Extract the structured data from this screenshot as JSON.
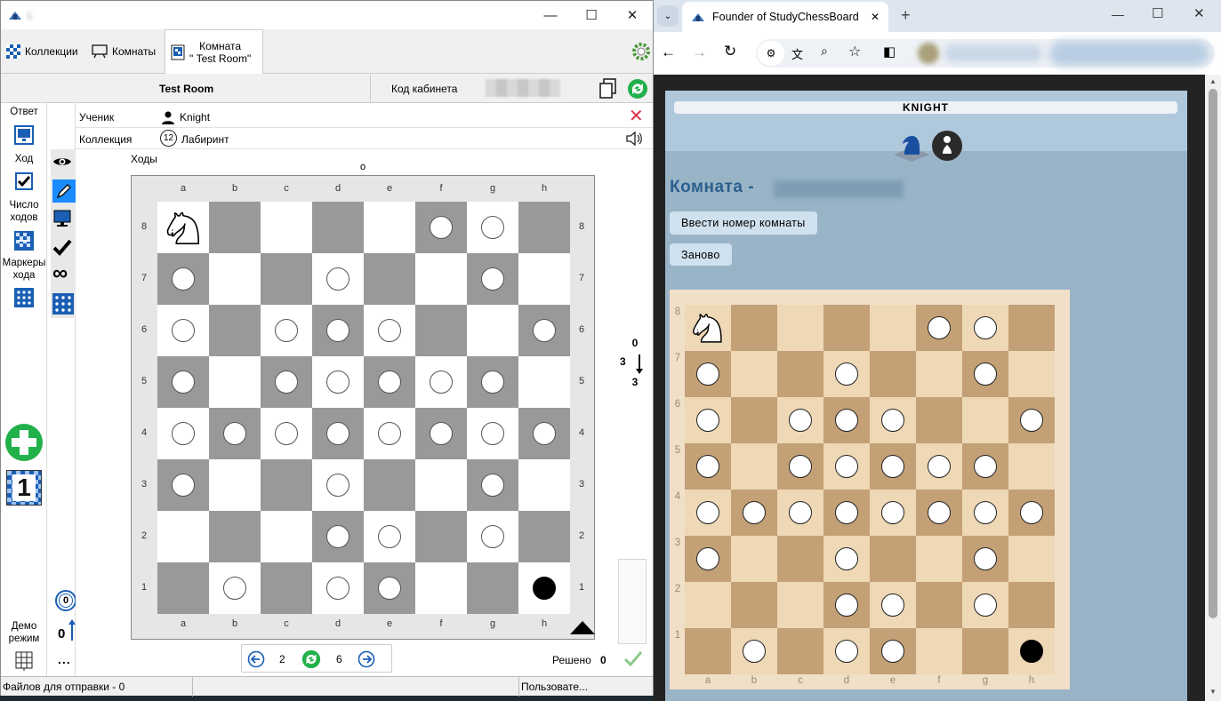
{
  "app": {
    "window_title": "L",
    "tabs": [
      {
        "label": "Коллекции"
      },
      {
        "label": "Комнаты"
      },
      {
        "label": "Комната\n\" Test Room\""
      }
    ],
    "header": {
      "room_name": "Test Room",
      "cabinet_code_label": "Код кабинета"
    },
    "left_panel": {
      "answer": "Ответ",
      "move": "Ход",
      "move_count": "Число ходов",
      "move_markers": "Маркеры хода",
      "demo": "Демо режим",
      "add_number": "1"
    },
    "info": {
      "student_label": "Ученик",
      "student_name": "Knight",
      "collection_label": "Коллекция",
      "collection_number": "12",
      "collection_name": "Лабиринт",
      "moves_label": "Ходы",
      "moves_marker": "o"
    },
    "board": {
      "files": [
        "a",
        "b",
        "c",
        "d",
        "e",
        "f",
        "g",
        "h"
      ],
      "ranks": [
        "8",
        "7",
        "6",
        "5",
        "4",
        "3",
        "2",
        "1"
      ],
      "knight": "a8",
      "white_stones": [
        "f8",
        "g8",
        "a7",
        "d7",
        "g7",
        "a6",
        "c6",
        "d6",
        "e6",
        "h6",
        "a5",
        "c5",
        "d5",
        "e5",
        "f5",
        "g5",
        "a4",
        "b4",
        "c4",
        "d4",
        "e4",
        "f4",
        "g4",
        "h4",
        "a3",
        "d3",
        "g3",
        "d2",
        "e2",
        "g2",
        "b1",
        "d1",
        "e1"
      ],
      "black_stones": [
        "h1"
      ]
    },
    "side_counter": {
      "top": "0",
      "mid": "3",
      "bottom": "3"
    },
    "bottom_nav": {
      "left": "2",
      "right": "6"
    },
    "zero_badge": "0",
    "zero_count": "0",
    "more": "...",
    "solved_label": "Решено",
    "solved_count": "0",
    "status": {
      "files_label": "Файлов для отправки -  0",
      "user_label": "Пользовате..."
    }
  },
  "browser": {
    "tab_title": "Founder of StudyChessBoard",
    "page": {
      "banner": "KNIGHT",
      "room_title": "Комната -",
      "enter_room_button": "Ввести номер комнаты",
      "restart_button": "Заново",
      "board": {
        "files": [
          "a",
          "b",
          "c",
          "d",
          "e",
          "f",
          "g",
          "h"
        ],
        "ranks": [
          "8",
          "7",
          "6",
          "5",
          "4",
          "3",
          "2",
          "1"
        ]
      }
    }
  },
  "colors": {
    "dark_square_1": "#999999",
    "light_square_1": "#ffffff",
    "dark_square_2": "#c4a076",
    "light_square_2": "#eed8b5",
    "page_bg": "#9ab4c7",
    "accent_blue": "#1a5fb4",
    "add_green": "#22b04b"
  }
}
